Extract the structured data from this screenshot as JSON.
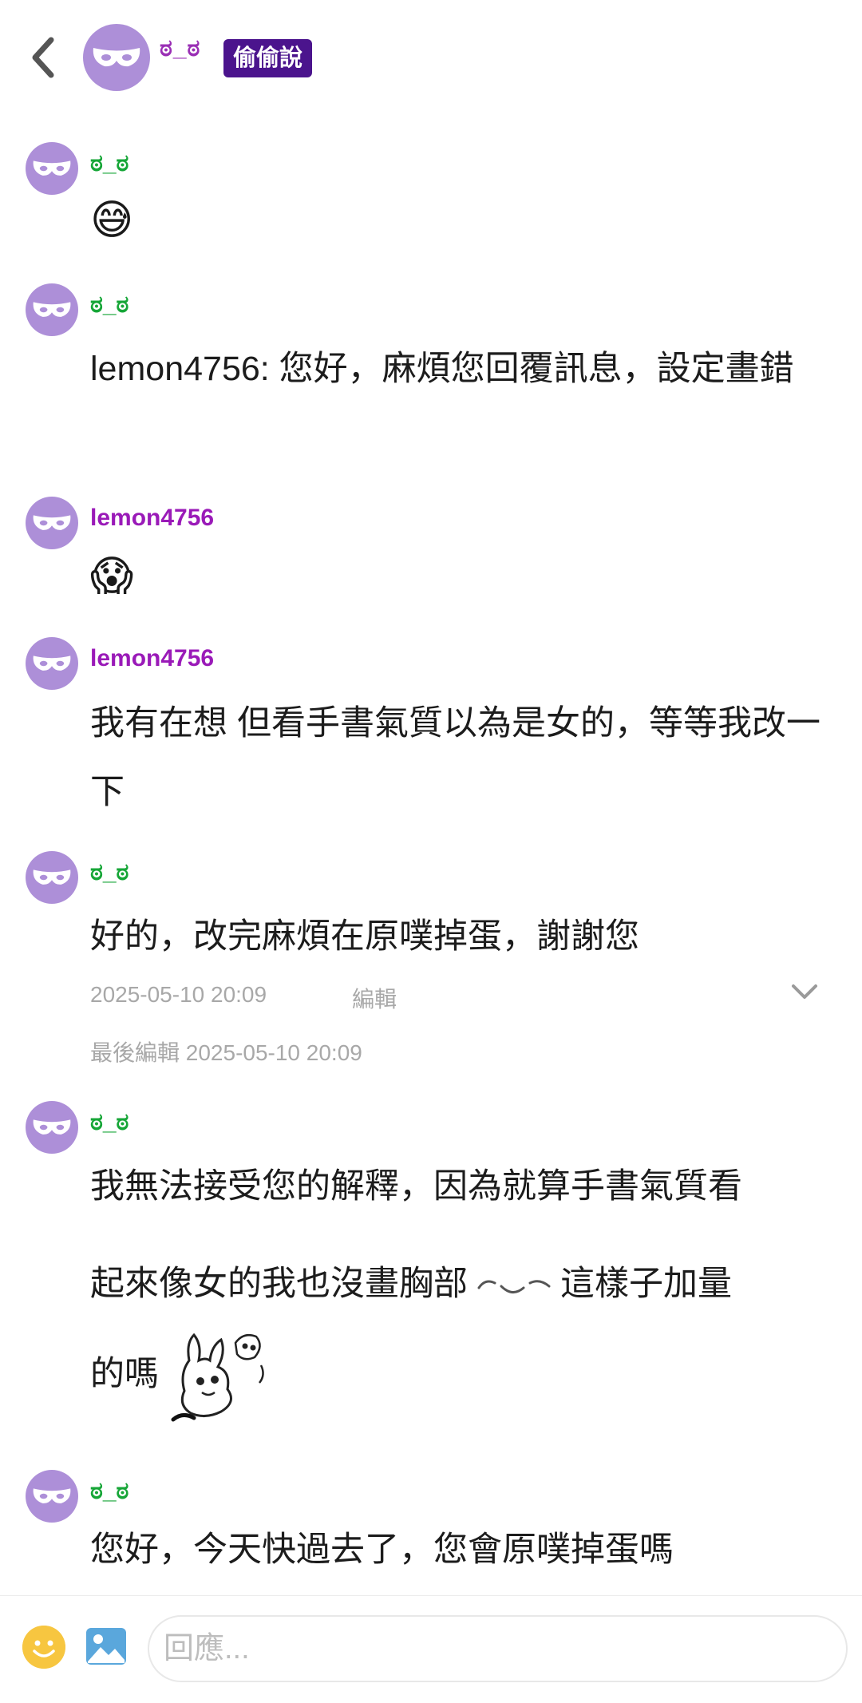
{
  "header": {
    "name": "ಠ_ಠ",
    "badge": "偷偷說"
  },
  "messages": [
    {
      "author": "ಠ_ಠ",
      "body": "😅"
    },
    {
      "author": "ಠ_ಠ",
      "body": "lemon4756: 您好，麻煩您回覆訊息，設定畫錯"
    },
    {
      "author": "lemon4756",
      "body": "😱"
    },
    {
      "author": "lemon4756",
      "body": "我有在想 但看手書氣質以為是女的，等等我改一下"
    },
    {
      "author": "ಠ_ಠ",
      "body": "好的，改完麻煩在原噗掉蛋，謝謝您",
      "timestamp": "2025-05-10 20:09",
      "edit_label": "編輯",
      "last_edited": "最後編輯 2025-05-10 20:09"
    },
    {
      "author": "ಠ_ಠ",
      "body_line1": "我無法接受您的解釋，因為就算手書氣質看",
      "body_line2a": "起來像女的我也沒畫胸部",
      "body_line2b": "這樣子加量",
      "body_line3": "的嗎"
    },
    {
      "author": "ಠ_ಠ",
      "body": "您好，今天快過去了，您會原噗掉蛋嗎"
    }
  ],
  "composer": {
    "placeholder": "回應..."
  },
  "colors": {
    "avatar": "#ad8fd8",
    "author_green": "#16a637",
    "author_purple": "#9a1ab8",
    "badge_bg": "#4b148d"
  },
  "icons": [
    "back-arrow-icon",
    "mask-icon",
    "chevron-down-icon",
    "smiley-icon",
    "photo-icon"
  ]
}
